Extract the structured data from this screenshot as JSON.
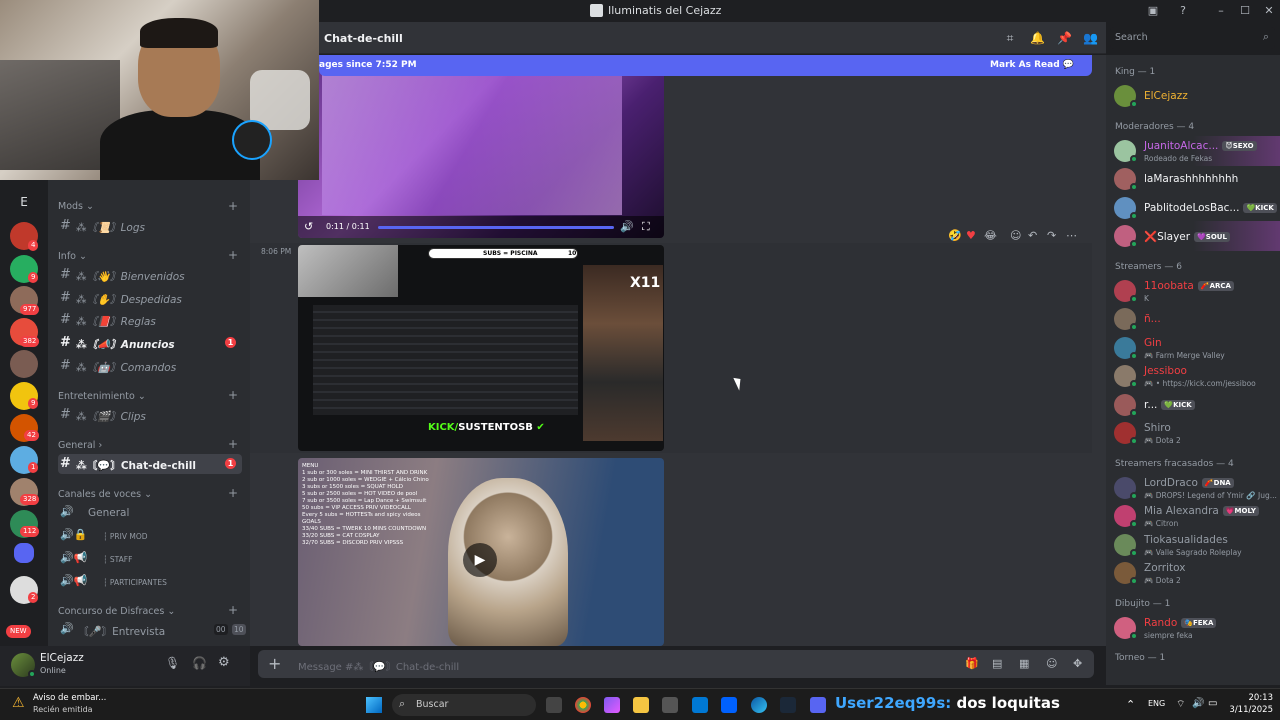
{
  "window": {
    "title": "Iluminatis del Cejazz",
    "controls": [
      "–",
      "☐",
      "✕"
    ]
  },
  "rail": {
    "badges": [
      "4",
      "9",
      "977",
      "382",
      "1",
      "9",
      "42",
      "1",
      "328",
      "112",
      "2"
    ],
    "letter": "E",
    "new_label": "NEW"
  },
  "channels": {
    "categories": {
      "mods": "Mods",
      "info": "Info",
      "entretenimiento": "Entretenimiento",
      "general": "General",
      "voz": "Canales de voces",
      "disfraces": "Concurso de Disfraces"
    },
    "items": [
      {
        "label": "⁂〘📜〙Logs"
      },
      {
        "label": "⁂〘👋〙Bienvenidos"
      },
      {
        "label": "⁂〘✋〙Despedidas"
      },
      {
        "label": "⁂〘📕〙Reglas"
      },
      {
        "label": "⁂〘📣〙Anuncios",
        "badge": "1"
      },
      {
        "label": "⁂〘🤖〙Comandos"
      },
      {
        "label": "⁂〘🎬〙Clips"
      },
      {
        "label": "⁂〘💬〙Chat-de-chill",
        "badge": "1"
      }
    ],
    "voice": [
      {
        "label": "General"
      },
      {
        "label": "┆ PRIV MOD"
      },
      {
        "label": "┆ STAFF"
      },
      {
        "label": "┆ PARTICIPANTES"
      },
      {
        "label": "〘🎤〙Entrevista",
        "count1": "00",
        "count2": "10"
      }
    ]
  },
  "user": {
    "name": "ElCejazz",
    "status": "Online"
  },
  "chat": {
    "channel_name": "Chat-de-chill",
    "banner_left": "ages since 7:52 PM",
    "banner_right": "Mark As Read",
    "video_time": "0:11 / 0:11",
    "timestamp": "8:06 PM",
    "stream_bar": "SUBS = PISCINA",
    "stream_bar_count": "10",
    "stream_kick_prefix": "KICK/",
    "stream_kick_name": "SUSTENTOSB",
    "stream_x": "X11",
    "menu_text": "MENU\n1 sub or 300 soles = MINI THIRST AND DRINK\n2 sub or 1000 soles = WEDGIE + Cálcio Chino\n3 subs or 1500 soles = SQUAT HOLD\n5 sub or 2500 soles = HOT VIDEO de pool\n7 sub or 3500 soles = Lap Dance + Swimsuit\n50 subs = VIP ACCESS PRIV VIDEOCALL\nEvery 5 subs = HOTTESTs and spicy videos\nGOALS\n33/40 SUBS = TWERK 10 MINS COUNTDOWN\n33/20 SUBS = CAT COSPLAY\n32/70 SUBS = DISCORD PRIV VIPSSS",
    "composer_placeholder": "Message #⁂〘💬〙Chat-de-chill"
  },
  "members": {
    "search_placeholder": "Search",
    "groups": [
      {
        "title": "King — 1",
        "members": [
          {
            "name": "ElCejazz",
            "color": "#f0b232"
          }
        ]
      },
      {
        "title": "Moderadores — 4",
        "members": [
          {
            "name": "JuanitoAlcac...",
            "color": "#c768e8",
            "tag": "😈SEXO",
            "sub": "Rodeado de Fekas"
          },
          {
            "name": "laMarashhhhhhhh",
            "color": "#f2f3f5"
          },
          {
            "name": "PablitodeLosBac...",
            "color": "#f2f3f5",
            "tag": "💚KICK"
          },
          {
            "name": "Slayer",
            "color": "#f2f3f5",
            "tag": "💜SOUL",
            "prefix": "❌"
          }
        ]
      },
      {
        "title": "Streamers — 6",
        "members": [
          {
            "name": "11oobata",
            "color": "#f23f43",
            "tag": "🧨ARCA",
            "sub": "K"
          },
          {
            "name": "ñ...",
            "color": "#f23f43"
          },
          {
            "name": "Gin",
            "color": "#f23f43",
            "sub": "🎮 Farm Merge Valley"
          },
          {
            "name": "Jessiboo",
            "color": "#f23f43",
            "sub": "🎮 • https://kick.com/jessiboo"
          },
          {
            "name": "r...",
            "color": "#f2f3f5",
            "tag": "💚KICK"
          },
          {
            "name": "Shiro",
            "color": "#949ba4",
            "sub": "🎮 Dota 2"
          }
        ]
      },
      {
        "title": "Streamers fracasados — 4",
        "members": [
          {
            "name": "LordDraco",
            "color": "#949ba4",
            "tag": "🧨DNA",
            "sub": "🎮 DROPS! Legend of Ymir 🔗 Jug..."
          },
          {
            "name": "Mia Alexandra",
            "color": "#949ba4",
            "tag": "💗MOLY",
            "sub": "🎮 Citron"
          },
          {
            "name": "Tiokasualidades",
            "color": "#949ba4",
            "sub": "🎮 Valle Sagrado Roleplay"
          },
          {
            "name": "Zorritox",
            "color": "#949ba4",
            "sub": "🎮 Dota 2"
          }
        ]
      },
      {
        "title": "Dibujito — 1",
        "members": [
          {
            "name": "Rando",
            "color": "#f23f43",
            "tag": "🎭FEKA",
            "sub": "siempre feka"
          }
        ]
      },
      {
        "title": "Torneo — 1",
        "members": []
      }
    ]
  },
  "taskbar": {
    "notif_title": "Aviso de embar...",
    "notif_sub": "Recién emitida",
    "search_placeholder": "Buscar",
    "overlay_user": "User22eq99s:",
    "overlay_msg": " dos loquitas",
    "lang": "ENG",
    "time": "20:13",
    "date": "3/11/2025"
  },
  "colors": {
    "accent": "#5865f2",
    "bg_chat": "#313338",
    "bg_sidebar": "#2b2d31",
    "bg_rail": "#1e1f22",
    "online": "#23a55a",
    "danger": "#f23f43"
  }
}
